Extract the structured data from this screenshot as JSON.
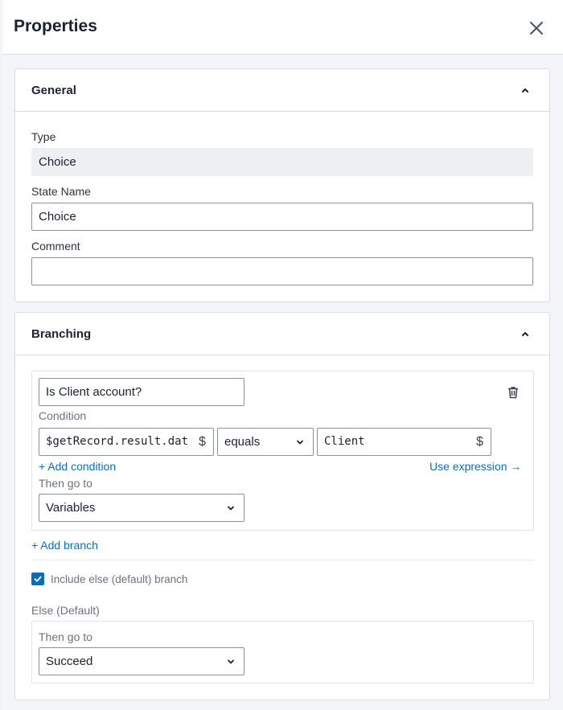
{
  "header": {
    "title": "Properties"
  },
  "icons": {
    "close": "close-icon",
    "collapse": "chevron-up-icon",
    "delete": "trash-icon",
    "dropdown": "chevron-down-icon",
    "check": "checkmark-icon"
  },
  "general": {
    "title": "General",
    "type_label": "Type",
    "type_value": "Choice",
    "state_name_label": "State Name",
    "state_name_value": "Choice",
    "comment_label": "Comment",
    "comment_value": ""
  },
  "branching": {
    "title": "Branching",
    "branch": {
      "name_value": "Is Client account?",
      "condition_label": "Condition",
      "left_operand": "$getRecord.result.dat",
      "left_dollar": "$",
      "operator": "equals",
      "right_operand": "Client",
      "right_dollar": "$",
      "add_condition": "+ Add condition",
      "use_expression": "Use expression →",
      "then_go_to_label": "Then go to",
      "then_go_to_value": "Variables"
    },
    "add_branch": "+ Add branch",
    "include_else_label": "Include else (default) branch",
    "include_else_checked": true,
    "else_label": "Else (Default)",
    "else_then_go_to_label": "Then go to",
    "else_then_go_to_value": "Succeed"
  },
  "colors": {
    "accent": "#0b6db5",
    "border": "#d7dce3",
    "background": "#f3f5f8"
  }
}
